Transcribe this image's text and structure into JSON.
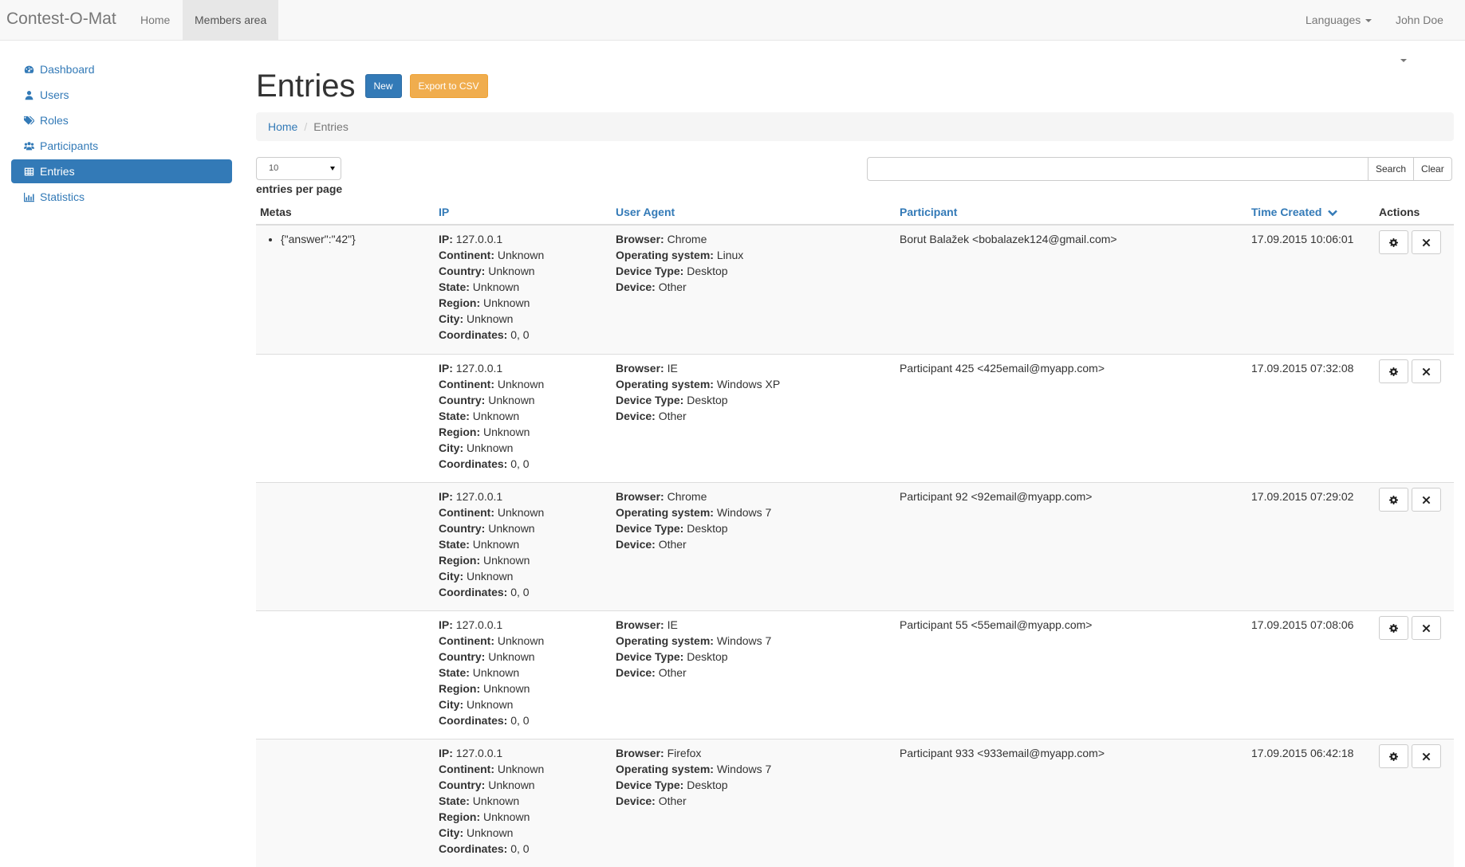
{
  "navbar": {
    "brand": "Contest-O-Mat",
    "links": [
      {
        "label": "Home",
        "active": false
      },
      {
        "label": "Members area",
        "active": true
      }
    ],
    "right": [
      {
        "label": "Languages"
      },
      {
        "label": "John Doe"
      }
    ]
  },
  "sidebar": {
    "items": [
      {
        "label": "Dashboard",
        "icon": "dashboard-icon",
        "active": false
      },
      {
        "label": "Users",
        "icon": "user-icon",
        "active": false
      },
      {
        "label": "Roles",
        "icon": "tags-icon",
        "active": false
      },
      {
        "label": "Participants",
        "icon": "users-icon",
        "active": false
      },
      {
        "label": "Entries",
        "icon": "table-icon",
        "active": true
      },
      {
        "label": "Statistics",
        "icon": "bar-chart-icon",
        "active": false
      }
    ]
  },
  "page": {
    "title": "Entries",
    "new_button": "New",
    "export_button": "Export to CSV",
    "colors": {
      "primary": "#337ab7",
      "warning": "#f0ad4e"
    }
  },
  "breadcrumb": {
    "items": [
      "Home",
      "Entries"
    ],
    "separator": "/"
  },
  "controls": {
    "per_page_value": "10",
    "per_page_label": "entries per page",
    "search_value": "",
    "search_button": "Search",
    "clear_button": "Clear"
  },
  "table": {
    "headers": {
      "metas": "Metas",
      "ip": "IP",
      "user_agent": "User Agent",
      "participant": "Participant",
      "time_created": "Time Created",
      "actions": "Actions"
    },
    "ip_labels": {
      "ip": "IP:",
      "continent": "Continent:",
      "country": "Country:",
      "state": "State:",
      "region": "Region:",
      "city": "City:",
      "coordinates": "Coordinates:"
    },
    "ua_labels": {
      "browser": "Browser:",
      "os": "Operating system:",
      "device_type": "Device Type:",
      "device": "Device:"
    },
    "rows": [
      {
        "metas": [
          "{\"answer\":\"42\"}"
        ],
        "ip": "127.0.0.1",
        "continent": "Unknown",
        "country": "Unknown",
        "state": "Unknown",
        "region": "Unknown",
        "city": "Unknown",
        "coordinates": "0, 0",
        "browser": "Chrome",
        "os": "Linux",
        "device_type": "Desktop",
        "device": "Other",
        "participant": "Borut Balažek <bobalazek124@gmail.com>",
        "time_created": "17.09.2015 10:06:01"
      },
      {
        "metas": [],
        "ip": "127.0.0.1",
        "continent": "Unknown",
        "country": "Unknown",
        "state": "Unknown",
        "region": "Unknown",
        "city": "Unknown",
        "coordinates": "0, 0",
        "browser": "IE",
        "os": "Windows XP",
        "device_type": "Desktop",
        "device": "Other",
        "participant": "Participant 425 <425email@myapp.com>",
        "time_created": "17.09.2015 07:32:08"
      },
      {
        "metas": [],
        "ip": "127.0.0.1",
        "continent": "Unknown",
        "country": "Unknown",
        "state": "Unknown",
        "region": "Unknown",
        "city": "Unknown",
        "coordinates": "0, 0",
        "browser": "Chrome",
        "os": "Windows 7",
        "device_type": "Desktop",
        "device": "Other",
        "participant": "Participant 92 <92email@myapp.com>",
        "time_created": "17.09.2015 07:29:02"
      },
      {
        "metas": [],
        "ip": "127.0.0.1",
        "continent": "Unknown",
        "country": "Unknown",
        "state": "Unknown",
        "region": "Unknown",
        "city": "Unknown",
        "coordinates": "0, 0",
        "browser": "IE",
        "os": "Windows 7",
        "device_type": "Desktop",
        "device": "Other",
        "participant": "Participant 55 <55email@myapp.com>",
        "time_created": "17.09.2015 07:08:06"
      },
      {
        "metas": [],
        "ip": "127.0.0.1",
        "continent": "Unknown",
        "country": "Unknown",
        "state": "Unknown",
        "region": "Unknown",
        "city": "Unknown",
        "coordinates": "0, 0",
        "browser": "Firefox",
        "os": "Windows 7",
        "device_type": "Desktop",
        "device": "Other",
        "participant": "Participant 933 <933email@myapp.com>",
        "time_created": "17.09.2015 06:42:18"
      }
    ]
  }
}
